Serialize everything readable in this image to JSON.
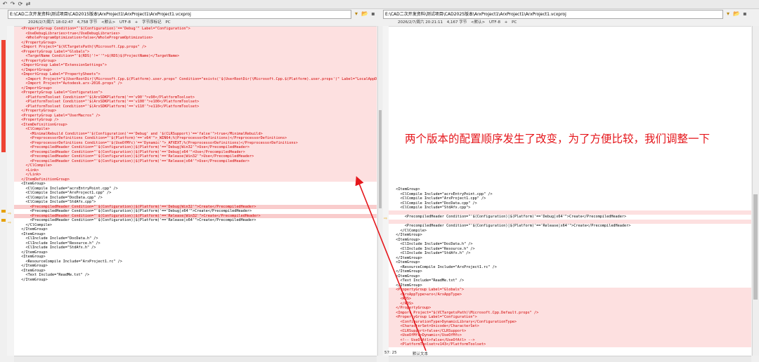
{
  "toolbar": {
    "buttons": [
      "undo-icon",
      "redo-icon",
      "refresh-icon",
      "swap-icon"
    ]
  },
  "left": {
    "path": "E:\\CAD二次开发资料\\测试项目\\CAD2015版本\\ArxProject1\\ArxProject1\\ArxProject1.vcxproj",
    "date": "2026/2/7/周六 18:02:47",
    "size": "4,758 字节",
    "encoding_default": "<默认>",
    "encoding": "UTF-8",
    "marker": "+",
    "lineending_label": "字节序标记",
    "lineending": "PC"
  },
  "right": {
    "path": "E:\\CAD二次开发资料\\测试项目\\CAD2025版本\\ArxProject1\\ArxProject1\\ArxProject1.vcxproj",
    "date": "2026/2/7/周六 20:21:11",
    "size": "4,167 字节",
    "encoding_default": "<默认>",
    "encoding": "UTF-8",
    "marker": "+",
    "lineending": "PC"
  },
  "left_lines": [
    {
      "t": "diff",
      "s": "  <PropertyGroup Condition=\"'$(Configuration)'=='Debug'\" Label=\"Configuration\">"
    },
    {
      "t": "diff",
      "s": "    <UseDebugLibraries>true</UseDebugLibraries>"
    },
    {
      "t": "diff",
      "s": "    <WholeProgramOptimization>false</WholeProgramOptimization>"
    },
    {
      "t": "diff",
      "s": "  </PropertyGroup>"
    },
    {
      "t": "diff",
      "s": "  <Import Project=\"$(VCTargetsPath)\\Microsoft.Cpp.props\" />"
    },
    {
      "t": "diff",
      "s": "  <PropertyGroup Label=\"Globals\">"
    },
    {
      "t": "diff",
      "s": "    <TargetName Condition=\"'$(RDS)'!=''\">$(RDS)$(ProjectName)</TargetName>"
    },
    {
      "t": "diff",
      "s": "  </PropertyGroup>"
    },
    {
      "t": "diff",
      "s": "  <ImportGroup Label=\"ExtensionSettings\">"
    },
    {
      "t": "diff",
      "s": "  </ImportGroup>"
    },
    {
      "t": "diff",
      "s": "  <ImportGroup Label=\"PropertySheets\">"
    },
    {
      "t": "diff",
      "s": "    <Import Project=\"$(UserRootDir)\\Microsoft.Cpp.$(Platform).user.props\" Condition=\"exists('$(UserRootDir)\\Microsoft.Cpp.$(Platform).user.props')\" Label=\"LocalAppDataPlatform\" />"
    },
    {
      "t": "diff",
      "s": "    <Import Project=\"Autodesk.arx-2016.props\" />"
    },
    {
      "t": "diff",
      "s": "  </ImportGroup>"
    },
    {
      "t": "diff",
      "s": "  <PropertyGroup Label=\"Configuration\">"
    },
    {
      "t": "diff",
      "s": "    <PlatformToolset Condition=\"'$(ArxSDKPlatform)'=='v90'\">v90</PlatformToolset>"
    },
    {
      "t": "diff",
      "s": "    <PlatformToolset Condition=\"'$(ArxSDKPlatform)'=='v100'\">v100</PlatformToolset>"
    },
    {
      "t": "diff",
      "s": "    <PlatformToolset Condition=\"'$(ArxSDKPlatform)'=='v110'\">v110</PlatformToolset>"
    },
    {
      "t": "diff",
      "s": "  </PropertyGroup>"
    },
    {
      "t": "diff",
      "s": "  <PropertyGroup Label=\"UserMacros\" />"
    },
    {
      "t": "diff",
      "s": "  <PropertyGroup />"
    },
    {
      "t": "diff",
      "s": "  <ItemDefinitionGroup>"
    },
    {
      "t": "diff",
      "s": "    <ClCompile>"
    },
    {
      "t": "diff",
      "s": "      <MinimalRebuild Condition=\"'$(Configuration)'=='Debug' and '$(CLRSupport)'=='false'\">true</MinimalRebuild>"
    },
    {
      "t": "diff",
      "s": "      <PreprocessorDefinitions Condition=\"'$(Platform)'=='x64'\">_WIN64;%(PreprocessorDefinitions)</PreprocessorDefinitions>"
    },
    {
      "t": "diff",
      "s": "      <PreprocessorDefinitions Condition=\"'$(UseOfMfc)'=='Dynamic'\">_AFXEXT;%(PreprocessorDefinitions)</PreprocessorDefinitions>"
    },
    {
      "t": "diff",
      "s": "      <PrecompiledHeader Condition=\"'$(Configuration)|$(Platform)'=='Debug|Win32'\">Use</PrecompiledHeader>"
    },
    {
      "t": "diff",
      "s": "      <PrecompiledHeader Condition=\"'$(Configuration)|$(Platform)'=='Debug|x64'\">Use</PrecompiledHeader>"
    },
    {
      "t": "diff",
      "s": "      <PrecompiledHeader Condition=\"'$(Configuration)|$(Platform)'=='Release|Win32'\">Use</PrecompiledHeader>"
    },
    {
      "t": "diff",
      "s": "      <PrecompiledHeader Condition=\"'$(Configuration)|$(Platform)'=='Release|x64'\">Use</PrecompiledHeader>"
    },
    {
      "t": "diff",
      "s": "    </ClCompile>"
    },
    {
      "t": "diff",
      "s": "    <Link>"
    },
    {
      "t": "diff",
      "s": "    </Link>"
    },
    {
      "t": "diff",
      "s": "  </ItemDefinitionGroup>"
    },
    {
      "t": "same",
      "s": "  <ItemGroup>"
    },
    {
      "t": "same",
      "s": "    <ClCompile Include=\"acrxEntryPoint.cpp\" />"
    },
    {
      "t": "same",
      "s": "    <ClCompile Include=\"ArxProject1.cpp\" />"
    },
    {
      "t": "same",
      "s": "    <ClCompile Include=\"DocData.cpp\" />"
    },
    {
      "t": "same",
      "s": "    <ClCompile Include=\"StdAfx.cpp\">"
    },
    {
      "t": "diffhl",
      "s": "      <PrecompiledHeader Condition=\"'$(Configuration)|$(Platform)'=='Debug|Win32'\">Create</PrecompiledHeader>"
    },
    {
      "t": "same",
      "s": "      <PrecompiledHeader Condition=\"'$(Configuration)|$(Platform)'=='Debug|x64'\">Create</PrecompiledHeader>"
    },
    {
      "t": "diffhl",
      "s": "      <PrecompiledHeader Condition=\"'$(Configuration)|$(Platform)'=='Release|Win32'\">Create</PrecompiledHeader>"
    },
    {
      "t": "same",
      "s": "      <PrecompiledHeader Condition=\"'$(Configuration)|$(Platform)'=='Release|x64'\">Create</PrecompiledHeader>"
    },
    {
      "t": "same",
      "s": "    </ClCompile>"
    },
    {
      "t": "same",
      "s": "  </ItemGroup>"
    },
    {
      "t": "same",
      "s": "  <ItemGroup>"
    },
    {
      "t": "same",
      "s": "    <ClInclude Include=\"DocData.h\" />"
    },
    {
      "t": "same",
      "s": "    <ClInclude Include=\"Resource.h\" />"
    },
    {
      "t": "same",
      "s": "    <ClInclude Include=\"StdAfx.h\" />"
    },
    {
      "t": "same",
      "s": "  </ItemGroup>"
    },
    {
      "t": "same",
      "s": "  <ItemGroup>"
    },
    {
      "t": "same",
      "s": "    <ResourceCompile Include=\"ArxProject1.rc\" />"
    },
    {
      "t": "same",
      "s": "  </ItemGroup>"
    },
    {
      "t": "same",
      "s": "  <ItemGroup>"
    },
    {
      "t": "same",
      "s": "    <Text Include=\"ReadMe.txt\" />"
    },
    {
      "t": "same",
      "s": "  </ItemGroup>"
    }
  ],
  "right_lines": [
    {
      "t": "same",
      "s": "  <ItemGroup>"
    },
    {
      "t": "same",
      "s": "    <ClCompile Include=\"acrxEntryPoint.cpp\" />"
    },
    {
      "t": "same",
      "s": "    <ClCompile Include=\"ArxProject1.cpp\" />"
    },
    {
      "t": "same",
      "s": "    <ClCompile Include=\"DocData.cpp\" />"
    },
    {
      "t": "same",
      "s": "    <ClCompile Include=\"StdAfx.cpp\">"
    },
    {
      "t": "empty",
      "s": ""
    },
    {
      "t": "same",
      "s": "      <PrecompiledHeader Condition=\"'$(Configuration)|$(Platform)'=='Debug|x64'\">Create</PrecompiledHeader>"
    },
    {
      "t": "empty",
      "s": ""
    },
    {
      "t": "same",
      "s": "      <PrecompiledHeader Condition=\"'$(Configuration)|$(Platform)'=='Release|x64'\">Create</PrecompiledHeader>"
    },
    {
      "t": "same",
      "s": "    </ClCompile>"
    },
    {
      "t": "same",
      "s": "  </ItemGroup>"
    },
    {
      "t": "same",
      "s": "  <ItemGroup>"
    },
    {
      "t": "same",
      "s": "    <ClInclude Include=\"DocData.h\" />"
    },
    {
      "t": "same",
      "s": "    <ClInclude Include=\"Resource.h\" />"
    },
    {
      "t": "same",
      "s": "    <ClInclude Include=\"StdAfx.h\" />"
    },
    {
      "t": "same",
      "s": "  </ItemGroup>"
    },
    {
      "t": "same",
      "s": "  <ItemGroup>"
    },
    {
      "t": "same",
      "s": "    <ResourceCompile Include=\"ArxProject1.rc\" />"
    },
    {
      "t": "same",
      "s": "  </ItemGroup>"
    },
    {
      "t": "same",
      "s": "  <ItemGroup>"
    },
    {
      "t": "same",
      "s": "    <Text Include=\"ReadMe.txt\" />"
    },
    {
      "t": "same",
      "s": "  </ItemGroup>"
    },
    {
      "t": "diff",
      "s": "  <PropertyGroup Label=\"Globals\">"
    },
    {
      "t": "diff",
      "s": "    <ArxAppType>arx</ArxAppType>"
    },
    {
      "t": "diff",
      "s": "    <RDS>"
    },
    {
      "t": "diff",
      "s": "    </RDS>"
    },
    {
      "t": "diff",
      "s": "  </PropertyGroup>"
    },
    {
      "t": "diff",
      "s": "  <Import Project=\"$(VCTargetsPath)\\Microsoft.Cpp.Default.props\" />"
    },
    {
      "t": "diff",
      "s": "  <PropertyGroup Label=\"Configuration\">"
    },
    {
      "t": "diff",
      "s": "    <ConfigurationType>DynamicLibrary</ConfigurationType>"
    },
    {
      "t": "diff",
      "s": "    <CharacterSet>Unicode</CharacterSet>"
    },
    {
      "t": "diff",
      "s": "    <CLRSupport>false</CLRSupport>"
    },
    {
      "t": "diff",
      "s": "    <UseOfMfc>Dynamic</UseOfMfc>"
    },
    {
      "t": "diff",
      "s": "    <!-- UseOfAtl>false</UseOfAtl> -->"
    },
    {
      "t": "diff",
      "s": "    <PlatformToolset>v143</PlatformToolset>"
    }
  ],
  "annotation": "两个版本的配置顺序发生了改变，为了方便比较，我们调整一下",
  "status": {
    "position": "57: 25",
    "mode": "默认文本"
  },
  "colors": {
    "diff_bg": "#fde0e0",
    "diff_text": "#d30000",
    "arrow": "#e5161b"
  }
}
